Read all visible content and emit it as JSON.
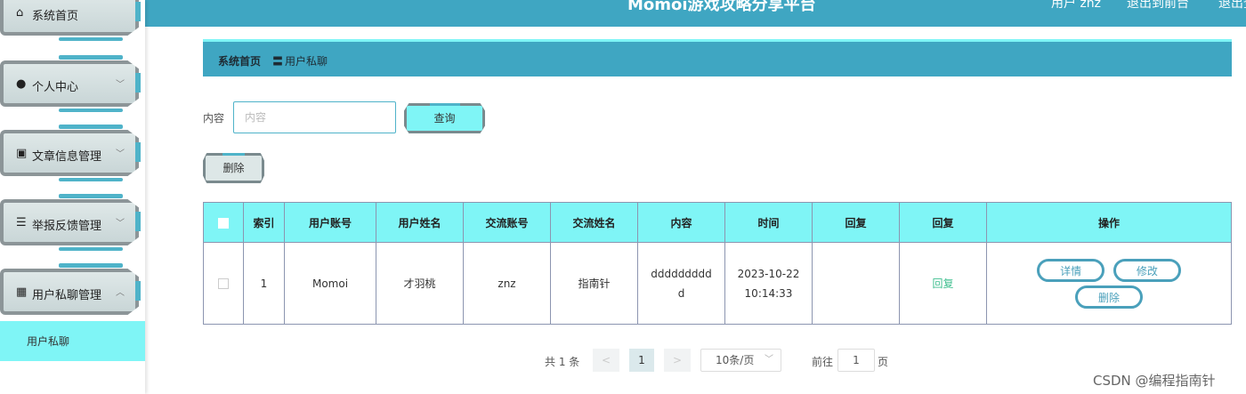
{
  "header": {
    "title": "Momoi游戏攻略分享平台",
    "user": "用户 znz",
    "back_link": "退出到前台",
    "logout": "退出登录"
  },
  "sidebar": {
    "items": [
      {
        "label": "系统首页",
        "icon": "home-icon",
        "has_chevron": false
      },
      {
        "label": "个人中心",
        "icon": "user-icon",
        "has_chevron": true
      },
      {
        "label": "文章信息管理",
        "icon": "clipboard-icon",
        "has_chevron": true
      },
      {
        "label": "举报反馈管理",
        "icon": "list-icon",
        "has_chevron": true
      },
      {
        "label": "用户私聊管理",
        "icon": "grid-icon",
        "has_chevron": true
      }
    ],
    "sub_item": {
      "label": "用户私聊",
      "active": true
    }
  },
  "breadcrumb": {
    "home": "系统首页",
    "separator": "〓",
    "current": "用户私聊"
  },
  "search": {
    "label": "内容",
    "placeholder": "内容",
    "value": "",
    "button": "查询"
  },
  "toolbar": {
    "delete_label": "删除"
  },
  "table": {
    "headers": [
      "",
      "索引",
      "用户账号",
      "用户姓名",
      "交流账号",
      "交流姓名",
      "内容",
      "时间",
      "回复",
      "回复",
      "操作"
    ],
    "rows": [
      {
        "index": "1",
        "user_account": "Momoi",
        "user_name": "才羽桃",
        "contact_account": "znz",
        "contact_name": "指南针",
        "content": "dddddddddd",
        "time": "2023-10-22 10:14:33",
        "reply": "",
        "reply_link": "回复",
        "actions": {
          "detail": "详情",
          "edit": "修改",
          "delete": "删除"
        }
      }
    ]
  },
  "pagination": {
    "total": "共 1 条",
    "prev": "<",
    "current_page": "1",
    "next": ">",
    "page_size": "10条/页",
    "goto_label": "前往",
    "goto_value": "1",
    "goto_suffix": "页"
  },
  "watermark": "CSDN @编程指南针",
  "colors": {
    "header": "#3fa6c2",
    "accent": "#7ff5f6",
    "button_border": "#4aa0bb",
    "reply_link": "#3fbf8f"
  }
}
